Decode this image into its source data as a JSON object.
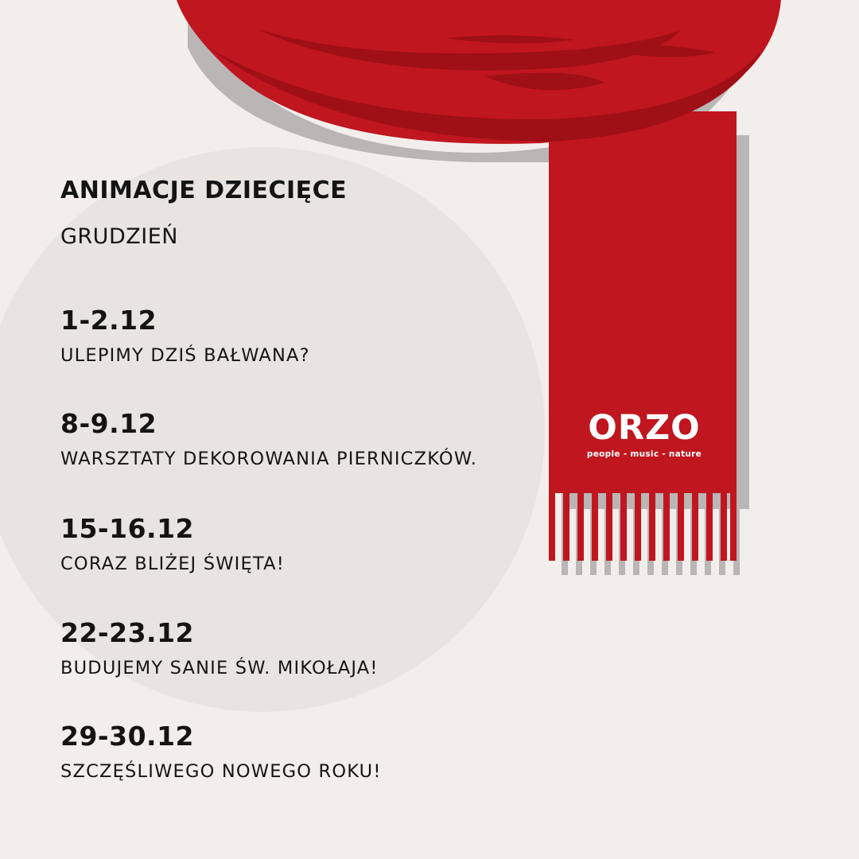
{
  "header": {
    "title": "ANIMACJE DZIECIĘCE",
    "subtitle": "GRUDZIEŃ"
  },
  "events": [
    {
      "date": "1-2.12",
      "description": "ULEPIMY DZIŚ BAŁWANA?"
    },
    {
      "date": "8-9.12",
      "description": "WARSZTATY DEKOROWANIA PIERNICZKÓW."
    },
    {
      "date": "15-16.12",
      "description": "CORAZ BLIŻEJ ŚWIĘTA!"
    },
    {
      "date": "22-23.12",
      "description": "BUDUJEMY SANIE ŚW. MIKOŁAJA!"
    },
    {
      "date": "29-30.12",
      "description": "SZCZĘŚLIWEGO NOWEGO ROKU!"
    }
  ],
  "logo": {
    "name": "ORZO",
    "tagline": "people - music - nature"
  },
  "colors": {
    "background": "#f2eeec",
    "circle": "#e8e4e2",
    "scarf": "#c0161f",
    "scarf_dark": "#9e0f16",
    "shadow": "#b9b6b5",
    "text": "#141414"
  }
}
